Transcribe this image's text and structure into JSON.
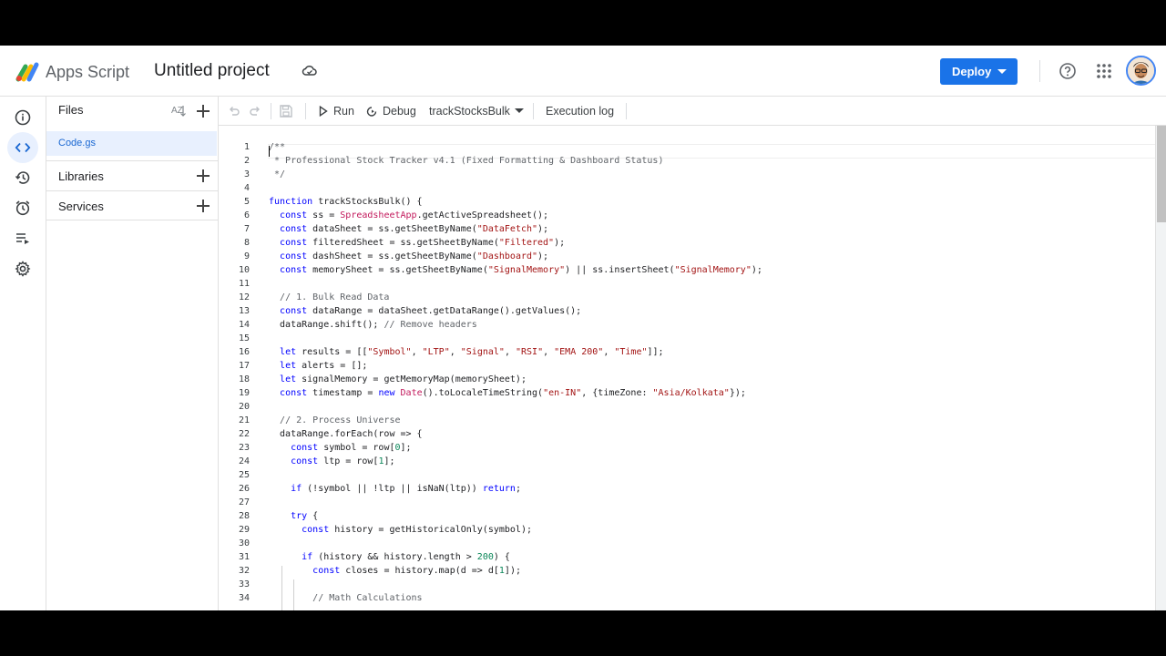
{
  "app": {
    "product_name": "Apps Script",
    "project_title": "Untitled project"
  },
  "header": {
    "deploy_label": "Deploy"
  },
  "files_panel": {
    "files_heading": "Files",
    "files": [
      {
        "name": "Code.gs",
        "selected": true
      }
    ],
    "libraries_label": "Libraries",
    "services_label": "Services"
  },
  "toolbar": {
    "run_label": "Run",
    "debug_label": "Debug",
    "function_selector": "trackStocksBulk",
    "execution_log_label": "Execution log"
  },
  "editor": {
    "lines": [
      {
        "n": "1",
        "code": "/**"
      },
      {
        "n": "2",
        "code": " * Professional Stock Tracker v4.1 (Fixed Formatting & Dashboard Status)"
      },
      {
        "n": "3",
        "code": " */"
      },
      {
        "n": "4",
        "code": ""
      },
      {
        "n": "5",
        "code": "function trackStocksBulk() {"
      },
      {
        "n": "6",
        "code": "  const ss = SpreadsheetApp.getActiveSpreadsheet();"
      },
      {
        "n": "7",
        "code": "  const dataSheet = ss.getSheetByName(\"DataFetch\");"
      },
      {
        "n": "8",
        "code": "  const filteredSheet = ss.getSheetByName(\"Filtered\");"
      },
      {
        "n": "9",
        "code": "  const dashSheet = ss.getSheetByName(\"Dashboard\");"
      },
      {
        "n": "10",
        "code": "  const memorySheet = ss.getSheetByName(\"SignalMemory\") || ss.insertSheet(\"SignalMemory\");"
      },
      {
        "n": "11",
        "code": ""
      },
      {
        "n": "12",
        "code": "  // 1. Bulk Read Data"
      },
      {
        "n": "13",
        "code": "  const dataRange = dataSheet.getDataRange().getValues();"
      },
      {
        "n": "14",
        "code": "  dataRange.shift(); // Remove headers"
      },
      {
        "n": "15",
        "code": ""
      },
      {
        "n": "16",
        "code": "  let results = [[\"Symbol\", \"LTP\", \"Signal\", \"RSI\", \"EMA 200\", \"Time\"]];"
      },
      {
        "n": "17",
        "code": "  let alerts = [];"
      },
      {
        "n": "18",
        "code": "  let signalMemory = getMemoryMap(memorySheet);"
      },
      {
        "n": "19",
        "code": "  const timestamp = new Date().toLocaleTimeString(\"en-IN\", {timeZone: \"Asia/Kolkata\"});"
      },
      {
        "n": "20",
        "code": ""
      },
      {
        "n": "21",
        "code": "  // 2. Process Universe"
      },
      {
        "n": "22",
        "code": "  dataRange.forEach(row => {"
      },
      {
        "n": "23",
        "code": "    const symbol = row[0];"
      },
      {
        "n": "24",
        "code": "    const ltp = row[1];"
      },
      {
        "n": "25",
        "code": ""
      },
      {
        "n": "26",
        "code": "    if (!symbol || !ltp || isNaN(ltp)) return;"
      },
      {
        "n": "27",
        "code": ""
      },
      {
        "n": "28",
        "code": "    try {"
      },
      {
        "n": "29",
        "code": "      const history = getHistoricalOnly(symbol);"
      },
      {
        "n": "30",
        "code": ""
      },
      {
        "n": "31",
        "code": "      if (history && history.length > 200) {"
      },
      {
        "n": "32",
        "code": "        const closes = history.map(d => d[1]);"
      },
      {
        "n": "33",
        "code": ""
      },
      {
        "n": "34",
        "code": "        // Math Calculations"
      }
    ]
  },
  "colors": {
    "accent": "#1a73e8",
    "keyword": "#0000ff",
    "string": "#a31515",
    "comment": "#5f6368",
    "number": "#098658"
  }
}
